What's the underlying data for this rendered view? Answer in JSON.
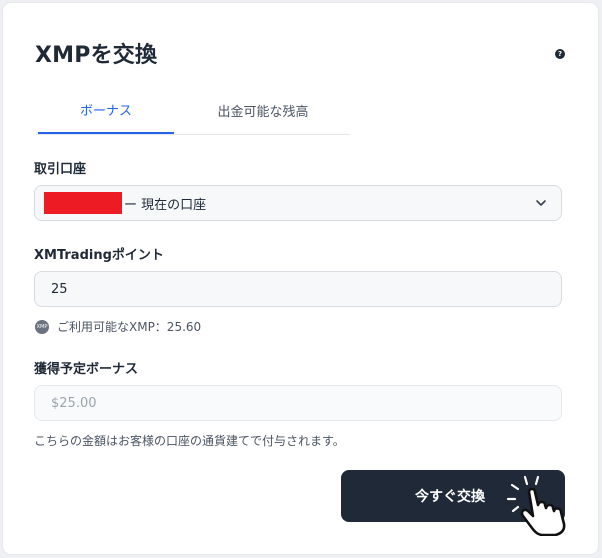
{
  "title": "XMPを交換",
  "help_icon": "?",
  "tabs": [
    {
      "label": "ボーナス",
      "active": true
    },
    {
      "label": "出金可能な残高",
      "active": false
    }
  ],
  "account": {
    "label": "取引口座",
    "value": "ー 現在の口座"
  },
  "points": {
    "label": "XMTradingポイント",
    "value": "25"
  },
  "available": {
    "badge": "XMP",
    "text": "ご利用可能なXMP：25.60"
  },
  "bonus": {
    "label": "獲得予定ボーナス",
    "value": "$25.00"
  },
  "note": "こちらの金額はお客様の口座の通貨建てで付与されます。",
  "exchange_button": "今すぐ交換",
  "colors": {
    "accent": "#2563eb",
    "button": "#1f2937",
    "redaction": "#ed1c24"
  }
}
